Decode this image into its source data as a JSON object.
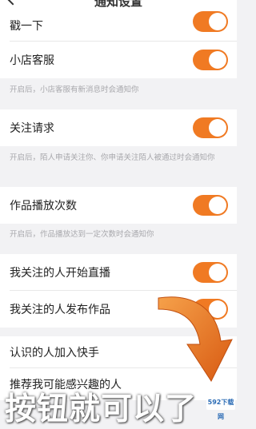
{
  "header": {
    "title": "通知设置"
  },
  "rows": {
    "poke": {
      "label": "戳一下",
      "on": true
    },
    "store_service": {
      "label": "小店客服",
      "on": true
    },
    "follow_request": {
      "label": "关注请求",
      "on": true
    },
    "play_count": {
      "label": "作品播放次数",
      "on": true
    },
    "live_start": {
      "label": "我关注的人开始直播",
      "on": true
    },
    "publish": {
      "label": "我关注的人发布作品",
      "on": true
    },
    "acquaintance_join": {
      "label": "认识的人加入快手"
    },
    "recommend": {
      "label": "推荐我可能感兴趣的人"
    }
  },
  "notes": {
    "store_service": "开启后，小店客服有新消息时会通知你",
    "follow_request": "开启后，陌人申请关注你、你申请关注陌人被通过时会通知你",
    "play_count": "开启后，作品播放达到一定次数时会通知你"
  },
  "overlay": {
    "caption": "按钮就可以了",
    "badge": "592下载网"
  },
  "colors": {
    "accent": "#f07a23",
    "background": "#f2f2f4"
  }
}
